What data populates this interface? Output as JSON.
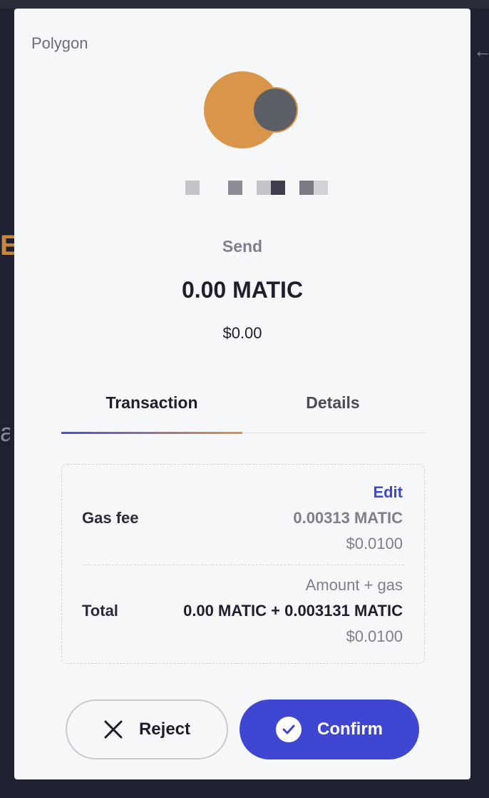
{
  "network": {
    "label": "Polygon"
  },
  "account": {
    "avatar_colors": {
      "primary": "#d9964a",
      "secondary": "#5d5f66"
    }
  },
  "transaction": {
    "type": "Send",
    "amount": "0.00 MATIC",
    "fiat": "$0.00"
  },
  "tabs": [
    {
      "label": "Transaction",
      "active": true
    },
    {
      "label": "Details",
      "active": false
    }
  ],
  "fee_card": {
    "edit_label": "Edit",
    "gas": {
      "label": "Gas fee",
      "crypto": "0.00313 MATIC",
      "fiat": "$0.0100"
    },
    "total": {
      "sublabel": "Amount + gas",
      "label": "Total",
      "crypto": "0.00 MATIC + 0.003131 MATIC",
      "fiat": "$0.0100"
    }
  },
  "actions": {
    "reject_label": "Reject",
    "confirm_label": "Confirm"
  },
  "colors": {
    "accent": "#3f46d2",
    "edit_link": "#4048c9",
    "tab_gradient_start": "#4a4fd6",
    "tab_gradient_end": "#d9964a",
    "background": "#1f2130",
    "modal": "#f6f7f9"
  }
}
